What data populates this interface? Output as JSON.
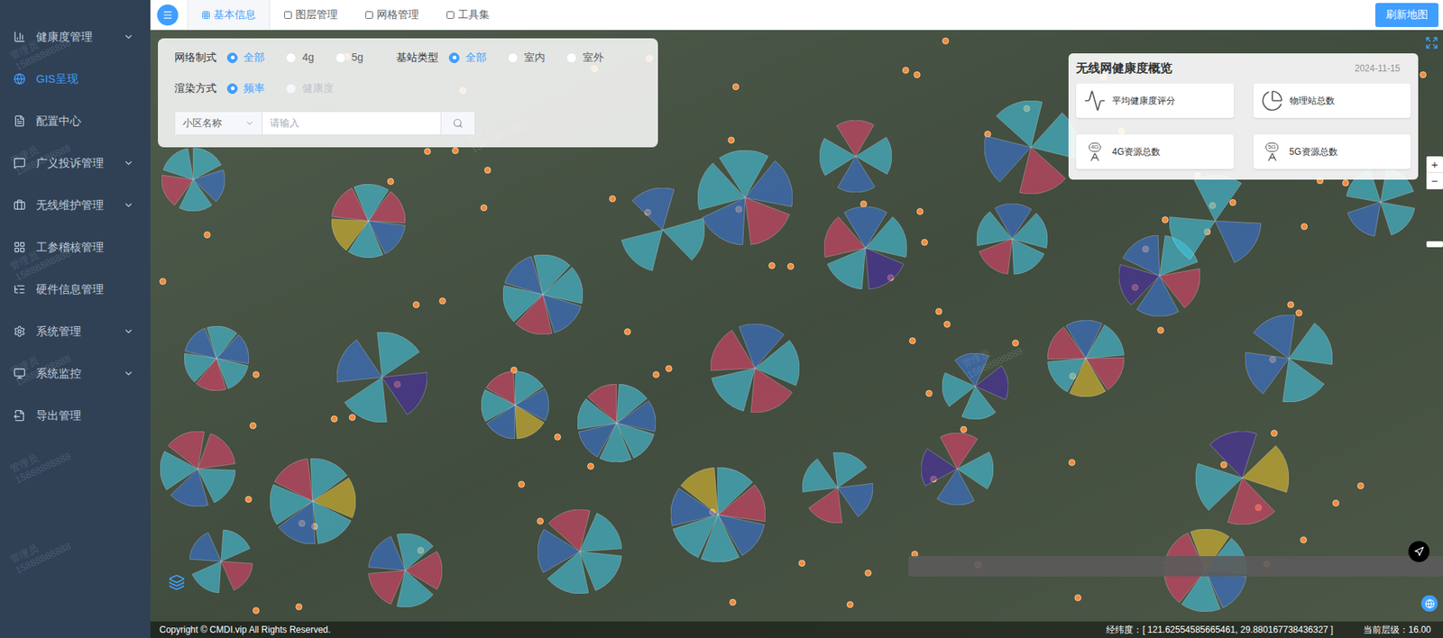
{
  "sidebar": {
    "items": [
      {
        "label": "健康度管理",
        "expandable": true,
        "selected": false
      },
      {
        "label": "GIS呈现",
        "expandable": false,
        "selected": true
      },
      {
        "label": "配置中心",
        "expandable": false,
        "selected": false
      },
      {
        "label": "广义投诉管理",
        "expandable": true,
        "selected": false
      },
      {
        "label": "无线维护管理",
        "expandable": true,
        "selected": false
      },
      {
        "label": "工参稽核管理",
        "expandable": false,
        "selected": false
      },
      {
        "label": "硬件信息管理",
        "expandable": false,
        "selected": false
      },
      {
        "label": "系统管理",
        "expandable": true,
        "selected": false
      },
      {
        "label": "系统监控",
        "expandable": true,
        "selected": false
      },
      {
        "label": "导出管理",
        "expandable": false,
        "selected": false
      }
    ]
  },
  "watermark": {
    "lines": [
      "管理员",
      "15888888888"
    ]
  },
  "topbar": {
    "tabs": [
      {
        "label": "基本信息",
        "selected": true
      },
      {
        "label": "图层管理",
        "selected": false
      },
      {
        "label": "网格管理",
        "selected": false
      },
      {
        "label": "工具集",
        "selected": false
      }
    ],
    "refresh_button": "刷新地图"
  },
  "filters": {
    "network": {
      "label": "网络制式",
      "options": [
        {
          "label": "全部",
          "selected": true,
          "disabled": false
        },
        {
          "label": "4g",
          "selected": false,
          "disabled": false
        },
        {
          "label": "5g",
          "selected": false,
          "disabled": false
        }
      ]
    },
    "station_type": {
      "label": "基站类型",
      "options": [
        {
          "label": "全部",
          "selected": true,
          "disabled": false
        },
        {
          "label": "室内",
          "selected": false,
          "disabled": false
        },
        {
          "label": "室外",
          "selected": false,
          "disabled": false
        }
      ]
    },
    "render": {
      "label": "渲染方式",
      "options": [
        {
          "label": "频率",
          "selected": true,
          "disabled": false
        },
        {
          "label": "健康度",
          "selected": false,
          "disabled": true
        }
      ]
    },
    "search": {
      "field": "小区名称",
      "placeholder": "请输入"
    }
  },
  "overview": {
    "title": "无线网健康度概览",
    "date": "2024-11-15",
    "cards": [
      {
        "label": "平均健康度评分",
        "kind": "pulse",
        "badge": ""
      },
      {
        "label": "物理站总数",
        "kind": "pie",
        "badge": ""
      },
      {
        "label": "4G资源总数",
        "kind": "antenna",
        "badge": "4G"
      },
      {
        "label": "5G资源总数",
        "kind": "antenna",
        "badge": "5G"
      }
    ]
  },
  "map": {
    "zoom_controls": [
      "+",
      "−"
    ],
    "sites": [
      {
        "sectors": [
          {
            "color": "#45c4e0"
          },
          {
            "color": "#3b74d6"
          },
          {
            "color": "#45c4e0"
          },
          {
            "color": "#e0436b"
          },
          {
            "color": "#45c4e0"
          }
        ]
      },
      {
        "sectors": [
          {
            "color": "#e0436b"
          },
          {
            "color": "#3b74d6"
          },
          {
            "color": "#45c4e0"
          },
          {
            "color": "#e3c02e"
          },
          {
            "color": "#e0436b"
          },
          {
            "color": "#45c4e0"
          }
        ]
      },
      {
        "sectors": [
          {
            "color": "#45c4e0"
          },
          {
            "color": "#45c4e0"
          },
          {
            "color": "#3b74d6"
          }
        ]
      },
      {
        "sectors": [
          {
            "color": "#e0436b"
          },
          {
            "color": "#3b74d6"
          },
          {
            "color": "#45c4e0"
          },
          {
            "color": "#45c4e0"
          },
          {
            "color": "#3b74d6"
          }
        ]
      },
      {
        "sectors": [
          {
            "color": "#3b74d6"
          },
          {
            "color": "#45c4e0"
          },
          {
            "color": "#e0436b"
          },
          {
            "color": "#45c4e0"
          }
        ]
      },
      {
        "sectors": [
          {
            "color": "#45c4e0"
          },
          {
            "color": "#e0436b"
          },
          {
            "color": "#3b74d6"
          },
          {
            "color": "#45c4e0"
          },
          {
            "color": "#4a2ba8"
          }
        ]
      },
      {
        "sectors": [
          {
            "color": "#3b74d6"
          },
          {
            "color": "#45c4e0"
          },
          {
            "color": "#45c4e0"
          },
          {
            "color": "#e0436b"
          }
        ]
      },
      {
        "sectors": [
          {
            "color": "#45c4e0"
          },
          {
            "color": "#3b74d6"
          },
          {
            "color": "#45c4e0"
          },
          {
            "color": "#45c4e0"
          },
          {
            "color": "#e0436b"
          }
        ]
      },
      {
        "sectors": [
          {
            "color": "#3b74d6"
          },
          {
            "color": "#45c4e0"
          },
          {
            "color": "#e0436b"
          },
          {
            "color": "#3b74d6"
          },
          {
            "color": "#4a2ba8"
          }
        ]
      },
      {
        "sectors": [
          {
            "color": "#45c4e0"
          },
          {
            "color": "#3b74d6"
          },
          {
            "color": "#45c4e0"
          }
        ]
      },
      {
        "sectors": [
          {
            "color": "#45c4e0"
          },
          {
            "color": "#45c4e0"
          },
          {
            "color": "#3b74d6"
          },
          {
            "color": "#45c4e0"
          }
        ]
      },
      {
        "sectors": [
          {
            "color": "#45c4e0"
          },
          {
            "color": "#3b74d6"
          },
          {
            "color": "#e0436b"
          },
          {
            "color": "#45c4e0"
          },
          {
            "color": "#3b74d6"
          },
          {
            "color": "#45c4e0"
          }
        ]
      },
      {
        "sectors": [
          {
            "color": "#4a2ba8"
          },
          {
            "color": "#45c4e0"
          },
          {
            "color": "#3b74d6"
          },
          {
            "color": "#45c4e0"
          }
        ]
      },
      {
        "sectors": [
          {
            "color": "#e3c02e"
          },
          {
            "color": "#3b74d6"
          },
          {
            "color": "#45c4e0"
          },
          {
            "color": "#e0436b"
          },
          {
            "color": "#45c4e0"
          },
          {
            "color": "#3b74d6"
          }
        ]
      },
      {
        "sectors": [
          {
            "color": "#45c4e0"
          },
          {
            "color": "#3b74d6"
          },
          {
            "color": "#45c4e0"
          },
          {
            "color": "#e0436b"
          },
          {
            "color": "#45c4e0"
          },
          {
            "color": "#3b74d6"
          },
          {
            "color": "#45c4e0"
          }
        ]
      },
      {
        "sectors": [
          {
            "color": "#45c4e0"
          },
          {
            "color": "#e0436b"
          },
          {
            "color": "#3b74d6"
          },
          {
            "color": "#45c4e0"
          },
          {
            "color": "#e0436b"
          }
        ]
      },
      {
        "sectors": [
          {
            "color": "#45c4e0"
          },
          {
            "color": "#3b74d6"
          },
          {
            "color": "#4a2ba8"
          },
          {
            "color": "#45c4e0"
          }
        ]
      },
      {
        "sectors": [
          {
            "color": "#e0436b"
          },
          {
            "color": "#3b74d6"
          },
          {
            "color": "#45c4e0"
          },
          {
            "color": "#e0436b"
          },
          {
            "color": "#e3c02e"
          },
          {
            "color": "#45c4e0"
          }
        ]
      },
      {
        "sectors": [
          {
            "color": "#3b74d6"
          },
          {
            "color": "#45c4e0"
          },
          {
            "color": "#45c4e0"
          },
          {
            "color": "#3b74d6"
          }
        ]
      },
      {
        "sectors": [
          {
            "color": "#45c4e0"
          },
          {
            "color": "#3b74d6"
          },
          {
            "color": "#45c4e0"
          },
          {
            "color": "#e0436b"
          },
          {
            "color": "#45c4e0"
          },
          {
            "color": "#3b74d6"
          }
        ]
      },
      {
        "sectors": [
          {
            "color": "#e0436b"
          },
          {
            "color": "#45c4e0"
          },
          {
            "color": "#3b74d6"
          },
          {
            "color": "#45c4e0"
          },
          {
            "color": "#e0436b"
          }
        ]
      },
      {
        "sectors": [
          {
            "color": "#e3c02e"
          },
          {
            "color": "#45c4e0"
          },
          {
            "color": "#3b74d6"
          },
          {
            "color": "#45c4e0"
          },
          {
            "color": "#e0436b"
          },
          {
            "color": "#45c4e0"
          }
        ]
      },
      {
        "sectors": [
          {
            "color": "#e0436b"
          },
          {
            "color": "#45c4e0"
          },
          {
            "color": "#3b74d6"
          },
          {
            "color": "#45c4e0"
          }
        ]
      },
      {
        "sectors": [
          {
            "color": "#45c4e0"
          },
          {
            "color": "#e0436b"
          },
          {
            "color": "#3b74d6"
          },
          {
            "color": "#45c4e0"
          },
          {
            "color": "#e0436b"
          }
        ]
      },
      {
        "sectors": [
          {
            "color": "#45c4e0"
          },
          {
            "color": "#3b74d6"
          },
          {
            "color": "#e0436b"
          },
          {
            "color": "#45c4e0"
          },
          {
            "color": "#45c4e0"
          }
        ]
      },
      {
        "sectors": [
          {
            "color": "#45c4e0"
          },
          {
            "color": "#3b74d6"
          },
          {
            "color": "#e3c02e"
          },
          {
            "color": "#45c4e0"
          },
          {
            "color": "#e0436b"
          },
          {
            "color": "#3b74d6"
          },
          {
            "color": "#45c4e0"
          }
        ]
      },
      {
        "sectors": [
          {
            "color": "#4a2ba8"
          },
          {
            "color": "#e0436b"
          },
          {
            "color": "#45c4e0"
          },
          {
            "color": "#3b74d6"
          }
        ]
      },
      {
        "sectors": [
          {
            "color": "#e0436b"
          },
          {
            "color": "#e3c02e"
          },
          {
            "color": "#45c4e0"
          },
          {
            "color": "#3b74d6"
          },
          {
            "color": "#45c4e0"
          },
          {
            "color": "#e0436b"
          }
        ]
      },
      {
        "sectors": [
          {
            "color": "#4a2ba8"
          },
          {
            "color": "#e3c02e"
          },
          {
            "color": "#e0436b"
          },
          {
            "color": "#45c4e0"
          }
        ]
      },
      {
        "sectors": [
          {
            "color": "#45c4e0"
          },
          {
            "color": "#3b74d6"
          },
          {
            "color": "#e0436b"
          },
          {
            "color": "#45c4e0"
          }
        ]
      }
    ]
  },
  "status_bar": {
    "copyright": "Copyright © CMDI.vip All Rights Reserved.",
    "coordinates": "经纬度：[ 121.62554585665461, 29.880167738436327 ]",
    "zoom_level": "当前层级：16.00"
  }
}
